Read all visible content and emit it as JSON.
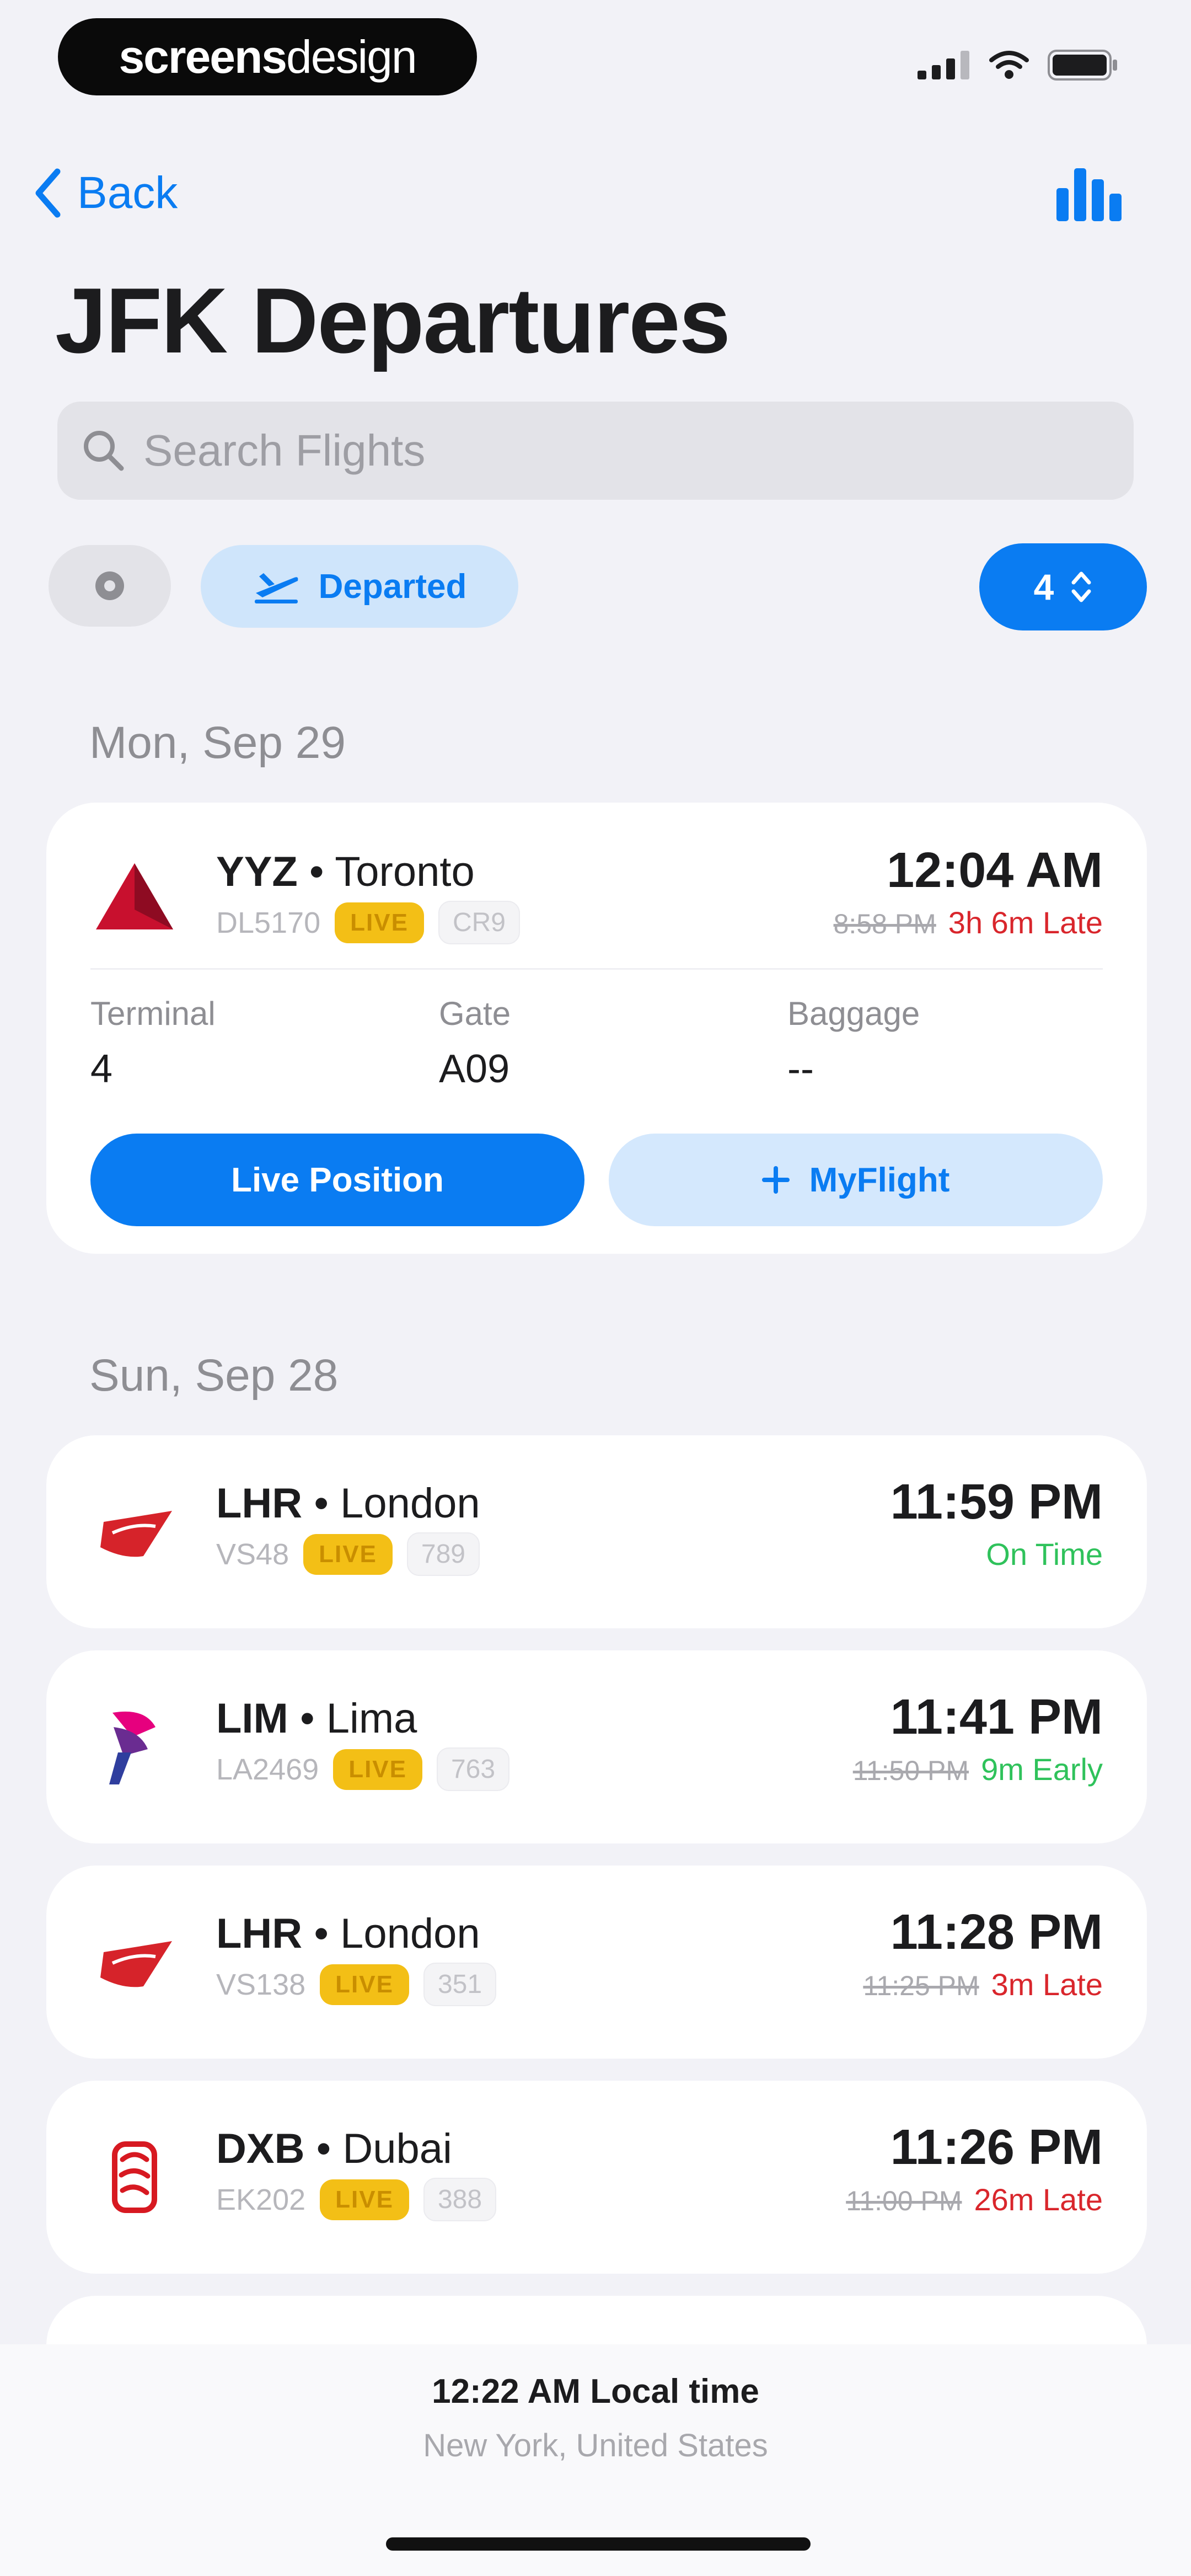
{
  "status_bar": {
    "brand_bold": "screens",
    "brand_light": "design"
  },
  "nav": {
    "back_label": "Back"
  },
  "title": "JFK Departures",
  "search": {
    "placeholder": "Search Flights"
  },
  "filters": {
    "departed_label": "Departed",
    "count_value": "4"
  },
  "sections": [
    {
      "date": "Mon, Sep 29",
      "flights": [
        {
          "code": "YYZ",
          "city": "Toronto",
          "flight_no": "DL5170",
          "live": "LIVE",
          "aircraft": "CR9",
          "time": "12:04 AM",
          "scheduled": "8:58 PM",
          "delay": "3h 6m Late",
          "status_color": "late",
          "details": {
            "terminal_label": "Terminal",
            "terminal": "4",
            "gate_label": "Gate",
            "gate": "A09",
            "baggage_label": "Baggage",
            "baggage": "--"
          },
          "actions": {
            "live_position": "Live Position",
            "myflight": "MyFlight"
          }
        }
      ]
    },
    {
      "date": "Sun, Sep 28",
      "flights": [
        {
          "code": "LHR",
          "city": "London",
          "flight_no": "VS48",
          "live": "LIVE",
          "aircraft": "789",
          "time": "11:59 PM",
          "scheduled": "",
          "delay": "On Time",
          "status_color": "early"
        },
        {
          "code": "LIM",
          "city": "Lima",
          "flight_no": "LA2469",
          "live": "LIVE",
          "aircraft": "763",
          "time": "11:41 PM",
          "scheduled": "11:50 PM",
          "delay": "9m Early",
          "status_color": "early"
        },
        {
          "code": "LHR",
          "city": "London",
          "flight_no": "VS138",
          "live": "LIVE",
          "aircraft": "351",
          "time": "11:28 PM",
          "scheduled": "11:25 PM",
          "delay": "3m Late",
          "status_color": "late"
        },
        {
          "code": "DXB",
          "city": "Dubai",
          "flight_no": "EK202",
          "live": "LIVE",
          "aircraft": "388",
          "time": "11:26 PM",
          "scheduled": "11:00 PM",
          "delay": "26m Late",
          "status_color": "late"
        }
      ]
    }
  ],
  "footer": {
    "local_time": "12:22 AM Local time",
    "location": "New York, United States"
  },
  "icons": {
    "back": "chevron-left-icon",
    "stats": "bar-chart-icon",
    "search": "search-icon",
    "filter": "gear-icon",
    "departed": "plane-departure-icon",
    "stepper": "chevron-up-down-icon",
    "add": "plus-icon"
  },
  "colors": {
    "accent": "#0a7cf2",
    "late": "#d9262c",
    "early": "#2fc25b",
    "live_badge": "#f3bf16",
    "background": "#f2f2f7",
    "card": "#ffffff"
  }
}
